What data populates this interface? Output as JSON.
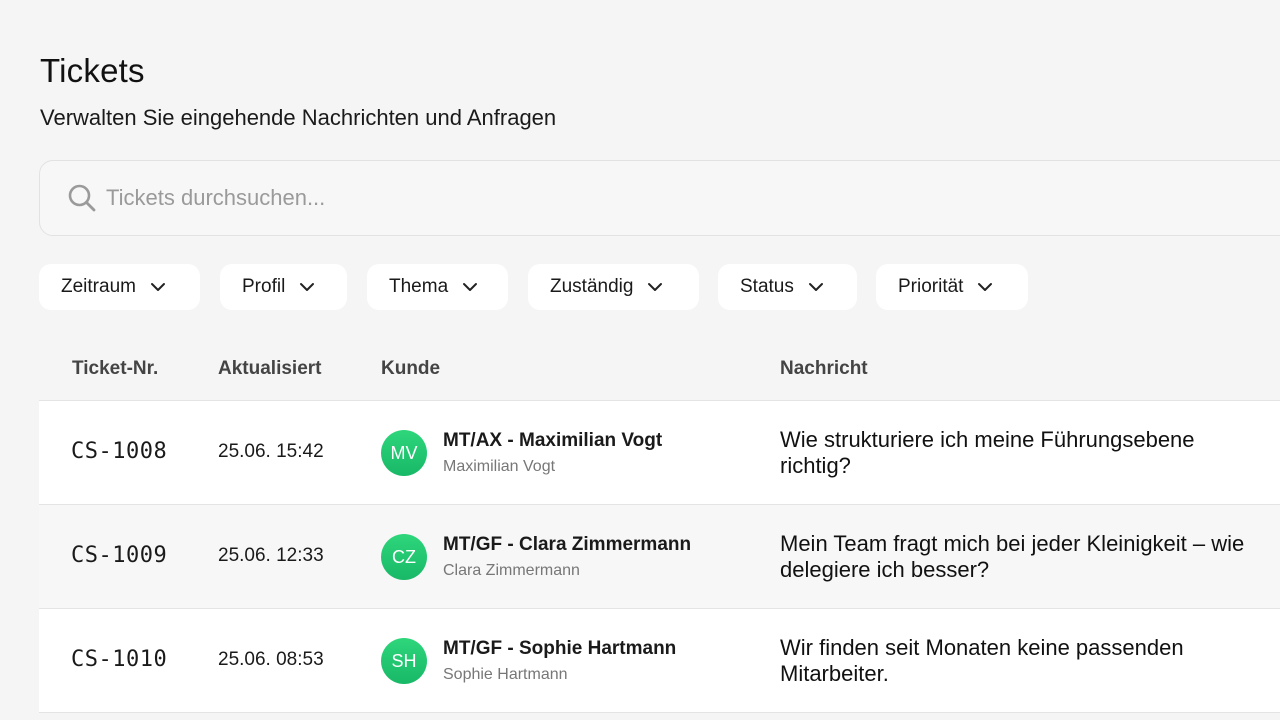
{
  "header": {
    "title": "Tickets",
    "subtitle": "Verwalten Sie eingehende Nachrichten und Anfragen"
  },
  "search": {
    "placeholder": "Tickets durchsuchen...",
    "value": "",
    "icon": "search-icon"
  },
  "filters": [
    {
      "label": "Zeitraum"
    },
    {
      "label": "Profil"
    },
    {
      "label": "Thema"
    },
    {
      "label": "Zuständig"
    },
    {
      "label": "Status"
    },
    {
      "label": "Priorität"
    }
  ],
  "table": {
    "columns": [
      "Ticket-Nr.",
      "Aktualisiert",
      "Kunde",
      "Nachricht"
    ],
    "rows": [
      {
        "id": "CS-1008",
        "updated": "25.06. 15:42",
        "initials": "MV",
        "customer": "MT/AX - Maximilian Vogt",
        "contact": "Maximilian Vogt",
        "message": "Wie strukturiere ich meine Führungsebene richtig?"
      },
      {
        "id": "CS-1009",
        "updated": "25.06. 12:33",
        "initials": "CZ",
        "customer": "MT/GF - Clara Zimmermann",
        "contact": "Clara Zimmermann",
        "message": "Mein Team fragt mich bei jeder Kleinigkeit – wie delegiere ich besser?"
      },
      {
        "id": "CS-1010",
        "updated": "25.06. 08:53",
        "initials": "SH",
        "customer": "MT/GF - Sophie Hartmann",
        "contact": "Sophie Hartmann",
        "message": "Wir finden seit Monaten keine passenden Mitarbeiter."
      }
    ]
  },
  "colors": {
    "background": "#f5f5f5",
    "avatar_green": "#22c772",
    "card": "#ffffff"
  }
}
